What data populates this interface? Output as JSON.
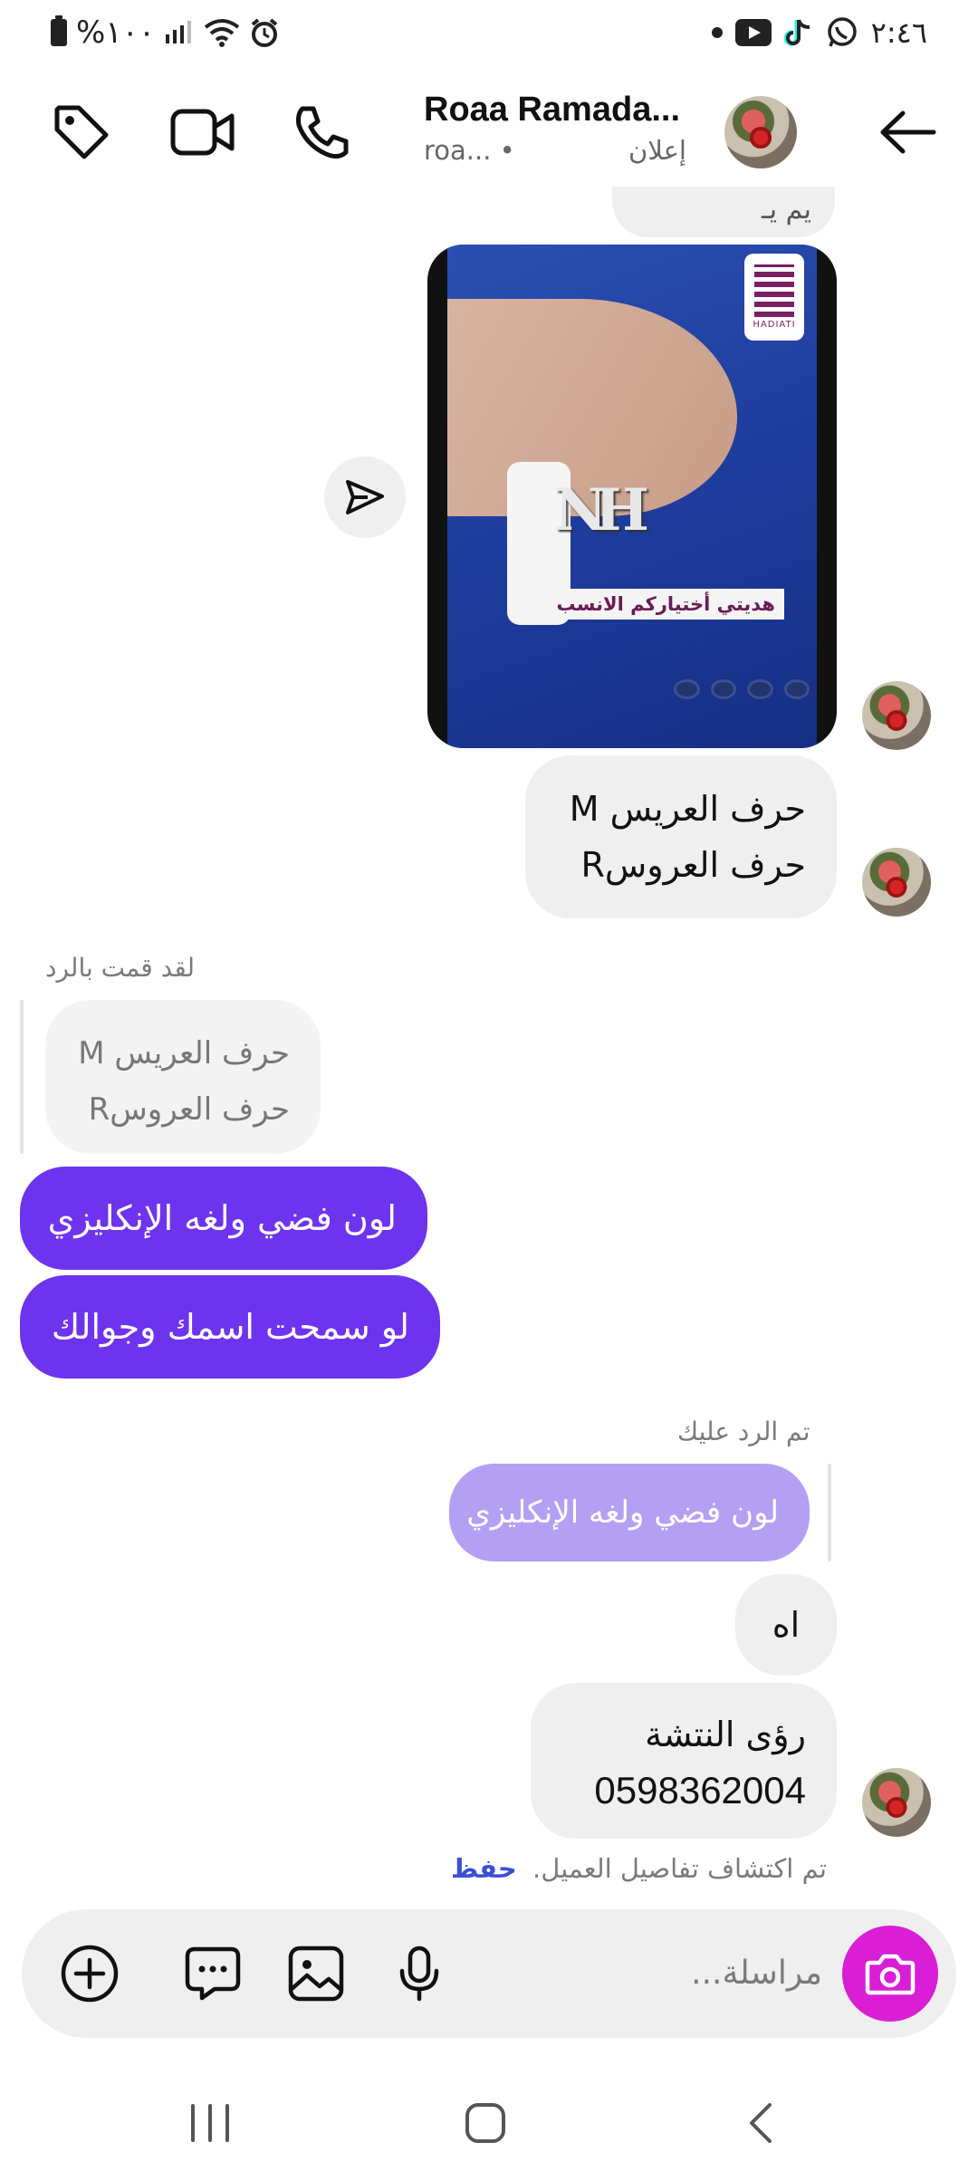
{
  "status_bar": {
    "time": "٢:٤٦",
    "battery": "%١٠٠"
  },
  "header": {
    "contact_name": "Roaa Ramada...",
    "contact_handle": "roa...",
    "ad_label": "إعلان"
  },
  "messages": {
    "partial_top_text": "يم يـ",
    "media_label": "هديتي أختياركم الانسب",
    "brand_text": "HADIATI",
    "cufflink_letters": "NH",
    "incoming_1": {
      "line1": "حرف العريس  M",
      "line2": "حرف العروسR"
    },
    "reply_context_label": "لقد قمت بالرد",
    "quoted_reply": {
      "line1": "حرف العريس  M",
      "line2": "حرف العروسR"
    },
    "outgoing_1": "لون فضي ولغه الإنكليزي",
    "outgoing_2": "لو سمحت اسمك وجوالك",
    "replied_to_you_label": "تم الرد عليك",
    "quoted_outgoing": "لون فضي ولغه الإنكليزي",
    "incoming_2": "اه",
    "incoming_3": {
      "line1": "رؤى النتشة",
      "line2": "0598362004"
    },
    "customer_detected_text": "تم اكتشاف تفاصيل العميل.",
    "save_link": "حفظ"
  },
  "composer": {
    "placeholder": "مراسلة..."
  },
  "icons": {
    "tag": "tag-icon",
    "video": "video-call-icon",
    "phone": "phone-icon",
    "back": "back-arrow-icon",
    "share": "send-icon",
    "camera": "camera-icon",
    "mic": "microphone-icon",
    "gallery": "image-icon",
    "sticker": "chat-bubble-icon",
    "plus": "add-circle-icon"
  },
  "colors": {
    "outgoing_bubble": "#6e33ee",
    "outgoing_quoted": "#b3a0f3",
    "incoming_bubble": "#efefef",
    "camera_button": "#d91ed6",
    "save_link": "#3b4fd6"
  }
}
